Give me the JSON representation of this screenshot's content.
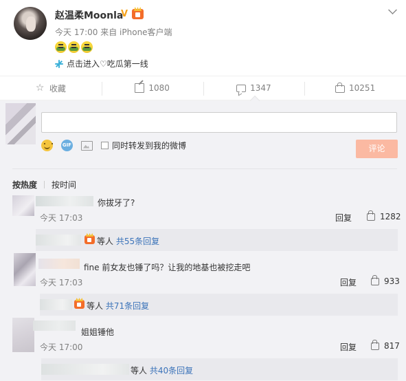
{
  "post": {
    "username": "赵温柔Moonla",
    "verified_mark": "V",
    "time": "今天 17:00",
    "source": "来自 iPhone客户端",
    "emojis": [
      "vomit-emoji",
      "vomit-emoji",
      "vomit-emoji"
    ],
    "link_text": "点击进入♡吃瓜第一线"
  },
  "actions": {
    "favorite": "收藏",
    "repost": "1080",
    "comment": "1347",
    "like": "10251"
  },
  "composer": {
    "repost_option": "同时转发到我的微博",
    "submit_label": "评论"
  },
  "sort": {
    "by_hot": "按热度",
    "by_time": "按时间"
  },
  "comments": [
    {
      "text": "你拔牙了?",
      "time": "今天 17:03",
      "reply_label": "回复",
      "likes": "1282",
      "replies_prefix": "等人",
      "replies_count": "共55条回复"
    },
    {
      "text": "fine 前女友也锤了吗？让我的地基也被挖走吧",
      "time": "今天 17:03",
      "reply_label": "回复",
      "likes": "933",
      "replies_prefix": "等人",
      "replies_count": "共71条回复"
    },
    {
      "text": "姐姐锤他",
      "time": "今天 17:00",
      "reply_label": "回复",
      "likes": "817",
      "replies_prefix": "等人",
      "replies_count": "共40条回复"
    }
  ],
  "colors": {
    "link_blue": "#3b73b9",
    "submit_disabled": "#fbb9a2",
    "comment_bg": "#f2f2f5",
    "verified": "#f5a21b"
  }
}
